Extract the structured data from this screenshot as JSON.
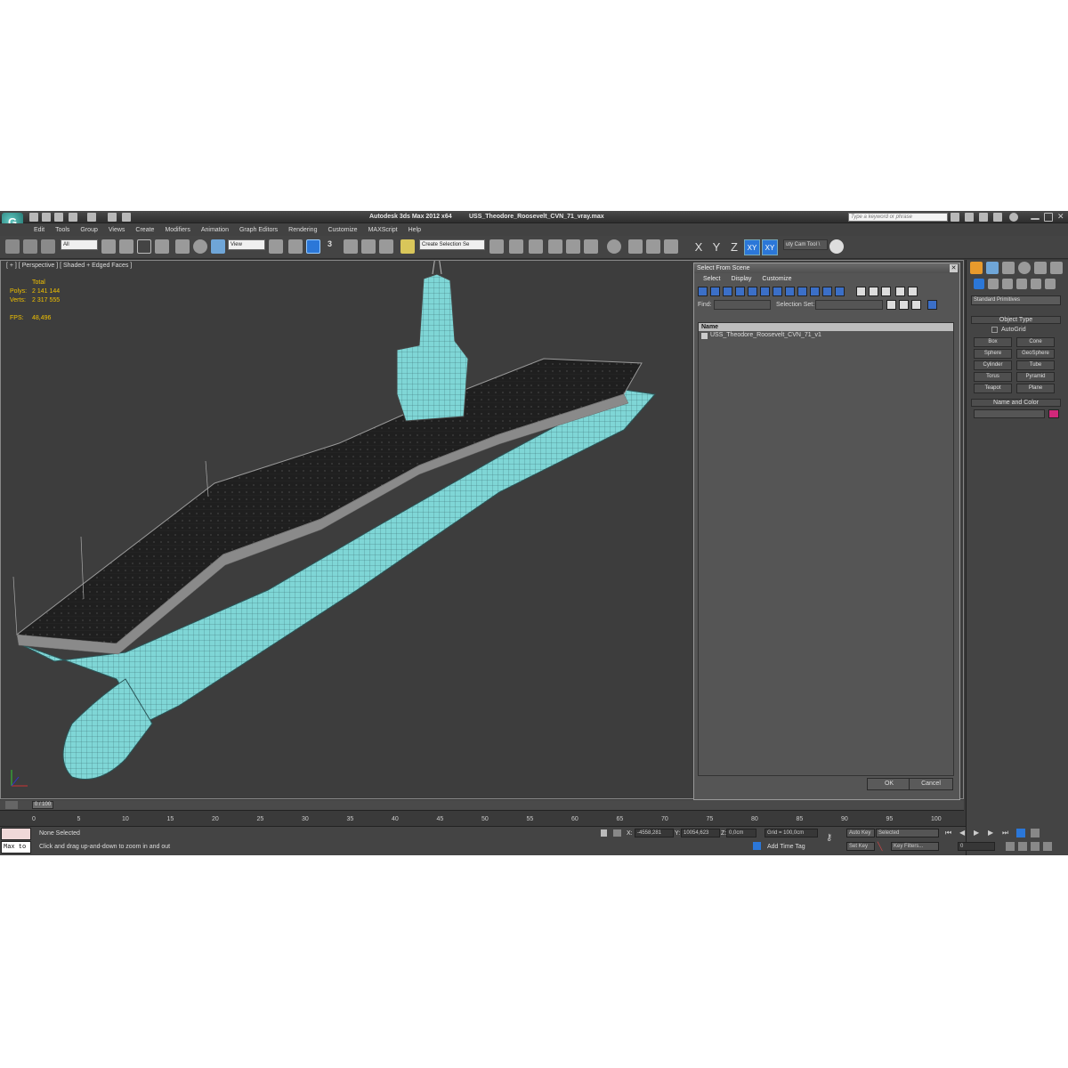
{
  "window": {
    "app_title": "Autodesk 3ds Max  2012 x64",
    "file_name": "USS_Theodore_Roosevelt_CVN_71_vray.max",
    "search_placeholder": "Type a keyword or phrase"
  },
  "menu": [
    "Edit",
    "Tools",
    "Group",
    "Views",
    "Create",
    "Modifiers",
    "Animation",
    "Graph Editors",
    "Rendering",
    "Customize",
    "MAXScript",
    "Help"
  ],
  "toolbar": {
    "filter_value": "All",
    "refcoord_value": "View",
    "selection_set_placeholder": "Create Selection Se",
    "axis_x": "X",
    "axis_y": "Y",
    "axis_z": "Z",
    "axis_xy": "XY",
    "axis_xy2": "XY",
    "snap_label": "3",
    "cam_tool": "uty Cam Tool \\"
  },
  "viewport": {
    "label": "[ + ] [ Perspective ] [ Shaded + Edged Faces ]",
    "stats_header": "Total",
    "polys_label": "Polys:",
    "polys_value": "2 141 144",
    "verts_label": "Verts:",
    "verts_value": "2 317 555",
    "fps_label": "FPS:",
    "fps_value": "48,496"
  },
  "dialog": {
    "title": "Select From Scene",
    "menu": [
      "Select",
      "Display",
      "Customize"
    ],
    "find_label": "Find:",
    "selset_label": "Selection Set:",
    "column_name": "Name",
    "item": "USS_Theodore_Roosevelt_CVN_71_v1",
    "ok": "OK",
    "cancel": "Cancel"
  },
  "command_panel": {
    "category": "Standard Primitives",
    "object_type_header": "Object Type",
    "autogrid": "AutoGrid",
    "buttons": [
      "Box",
      "Cone",
      "Sphere",
      "GeoSphere",
      "Cylinder",
      "Tube",
      "Torus",
      "Pyramid",
      "Teapot",
      "Plane"
    ],
    "name_color_header": "Name and Color",
    "color": "#d0287a"
  },
  "timeline": {
    "slider_label": "0 / 100",
    "ticks": [
      "0",
      "5",
      "10",
      "15",
      "20",
      "25",
      "30",
      "35",
      "40",
      "45",
      "50",
      "55",
      "60",
      "65",
      "70",
      "75",
      "80",
      "85",
      "90",
      "95",
      "100"
    ]
  },
  "status": {
    "maxscript": "Max to",
    "selection": "None Selected",
    "prompt": "Click and drag up-and-down to zoom in and out",
    "x_label": "X:",
    "x_value": "-4558,281",
    "y_label": "Y:",
    "y_value": "10054,623",
    "z_label": "Z:",
    "z_value": "0,0cm",
    "grid": "Grid = 100,0cm",
    "add_time_tag": "Add Time Tag",
    "auto_key": "Auto Key",
    "set_key": "Set Key",
    "key_mode": "Selected",
    "key_filters": "Key Filters...",
    "frame": "0"
  },
  "colors": {
    "mesh": "#7fd6d6",
    "accent": "#2b77d8",
    "stats": "#f2c200"
  }
}
